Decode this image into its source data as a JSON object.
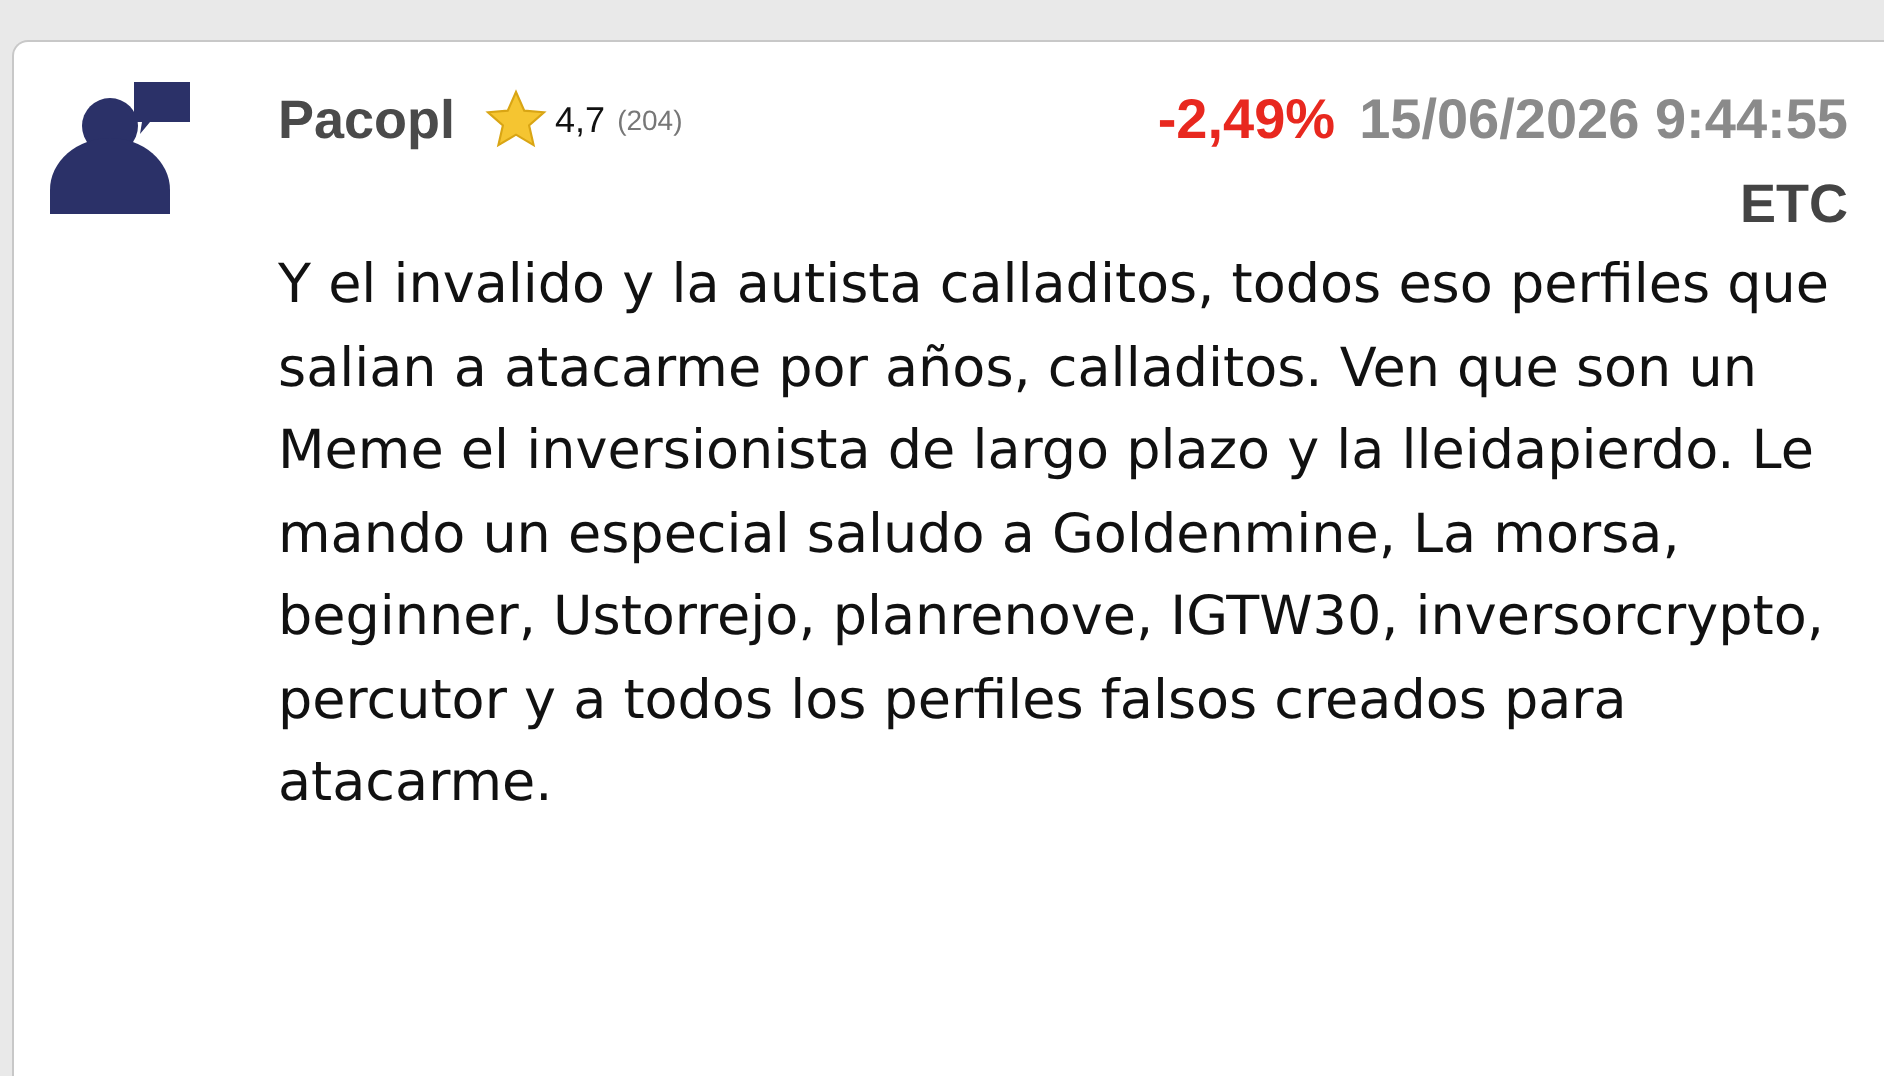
{
  "post": {
    "author": "Pacopl",
    "rating": "4,7",
    "rating_count": "(204)",
    "change": "-2,49%",
    "timestamp": "15/06/2026 9:44:55",
    "ticker": "ETC",
    "body": "Y el invalido y la autista calladitos, todos eso perfiles que salian a atacarme por años, calladitos. Ven que son un Meme el inversionista de largo plazo y la lleidapierdo. Le mando un especial saludo a Goldenmine, La morsa, beginner, Ustorrejo, planrenove, IGTW30, inversorcrypto, percutor y a todos los perfiles falsos creados para atacarme."
  }
}
